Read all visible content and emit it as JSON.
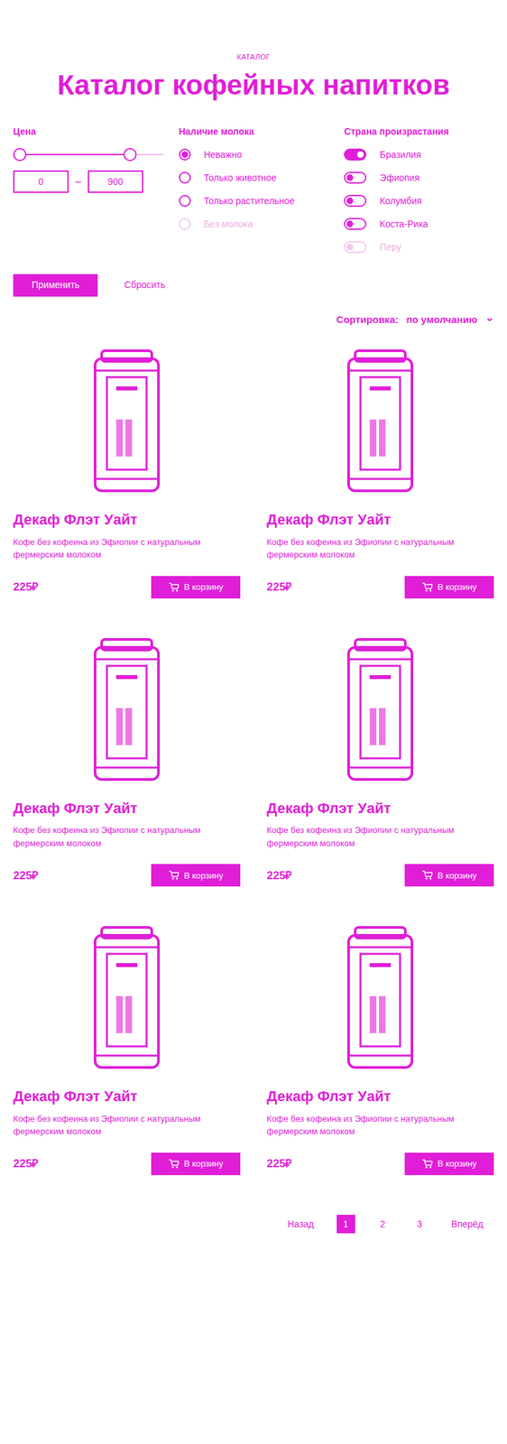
{
  "eyebrow": "КАТАЛОГ",
  "title": "Каталог кофейных напитков",
  "filters": {
    "price": {
      "label": "Цена",
      "min": "0",
      "max": "900",
      "dash": "–",
      "low_level": 0,
      "level": 0.78
    },
    "milk": {
      "label": "Наличие молока",
      "options": [
        {
          "label": "Неважно",
          "selected": true,
          "disabled": false
        },
        {
          "label": "Только животное",
          "selected": false,
          "disabled": false
        },
        {
          "label": "Только растительное",
          "selected": false,
          "disabled": false
        },
        {
          "label": "Без молока",
          "selected": false,
          "disabled": true
        }
      ]
    },
    "country": {
      "label": "Страна произрастания",
      "options": [
        {
          "label": "Бразилия",
          "on": true,
          "disabled": false
        },
        {
          "label": "Эфиопия",
          "on": false,
          "disabled": false
        },
        {
          "label": "Колумбия",
          "on": false,
          "disabled": false
        },
        {
          "label": "Коста-Рика",
          "on": false,
          "disabled": false
        },
        {
          "label": "Перу",
          "on": false,
          "disabled": true
        }
      ]
    }
  },
  "apply": "Применить",
  "reset": "Сбросить",
  "sort": {
    "label": "Сортировка:",
    "value": "по умолчанию",
    "icon": "⌄"
  },
  "products": [
    {
      "name": "Декаф Флэт Уайт",
      "description": "Кофе без кофеина из Эфиопии с натуральным фермерским молоком",
      "price": "225₽",
      "button": "В корзину"
    },
    {
      "name": "Декаф Флэт Уайт",
      "description": "Кофе без кофеина из Эфиопии с натуральным фермерским молоком",
      "price": "225₽",
      "button": "В корзину"
    },
    {
      "name": "Декаф Флэт Уайт",
      "description": "Кофе без кофеина из Эфиопии с натуральным фермерским молоком",
      "price": "225₽",
      "button": "В корзину"
    },
    {
      "name": "Декаф Флэт Уайт",
      "description": "Кофе без кофеина из Эфиопии с натуральным фермерским молоком",
      "price": "225₽",
      "button": "В корзину"
    },
    {
      "name": "Декаф Флэт Уайт",
      "description": "Кофе без кофеина из Эфиопии с натуральным фермерским молоком",
      "price": "225₽",
      "button": "В корзину"
    },
    {
      "name": "Декаф Флэт Уайт",
      "description": "Кофе без кофеина из Эфиопии с натуральным фермерским молоком",
      "price": "225₽",
      "button": "В корзину"
    }
  ],
  "pagination": {
    "prev": "Назад",
    "pages": [
      {
        "label": "1",
        "selected": true
      },
      {
        "label": "2",
        "selected": false
      },
      {
        "label": "3",
        "selected": false
      }
    ],
    "next": "Вперёд"
  }
}
